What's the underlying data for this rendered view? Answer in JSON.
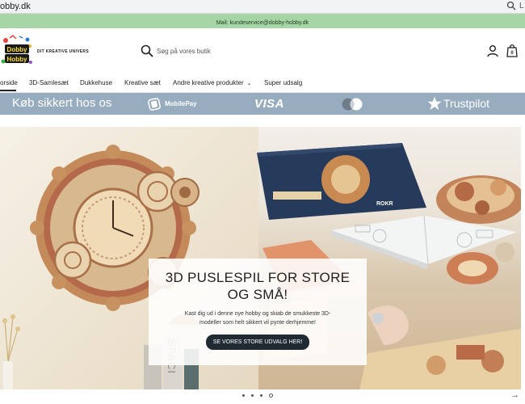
{
  "browser": {
    "url": "obby.dk",
    "more_label": "L"
  },
  "infobar": {
    "text": "Mail: kundeservice@dobby-hobby.dk"
  },
  "header": {
    "logo_text_1": "Dobby",
    "logo_text_2": "Hobby",
    "tagline": "DIT KREATIVE UNIVERS",
    "search_placeholder": "Søg på vores butik",
    "cart_count": "0"
  },
  "nav": {
    "items": [
      {
        "label": "orside"
      },
      {
        "label": "3D-Samlesæt"
      },
      {
        "label": "Dukkehuse"
      },
      {
        "label": "Kreative sæt"
      },
      {
        "label": "Andre kreative produkter"
      },
      {
        "label": "Super udsalg"
      }
    ]
  },
  "trust": {
    "title": "Køb sikkert hos os",
    "mobilepay": "MobilePay",
    "visa": "VISA",
    "trustpilot": "Trustpilot"
  },
  "hero": {
    "heading": "3D PUSLESPIL FOR STORE OG SMÅ!",
    "text": "Kast dig ud i denne nye hobby og skiab de smukkeste 3D-modeller som helt sikkert vil pynte derhjemme!",
    "cta": "SE VORES STORE UDVALG HER!",
    "box_brand": "ROKR",
    "book_text": "SPACI",
    "slides_count": 4,
    "active_slide": 4
  },
  "colors": {
    "infobar": "#a7d6a6",
    "trustbar": "#98acc0",
    "cta": "#1f2a33"
  }
}
